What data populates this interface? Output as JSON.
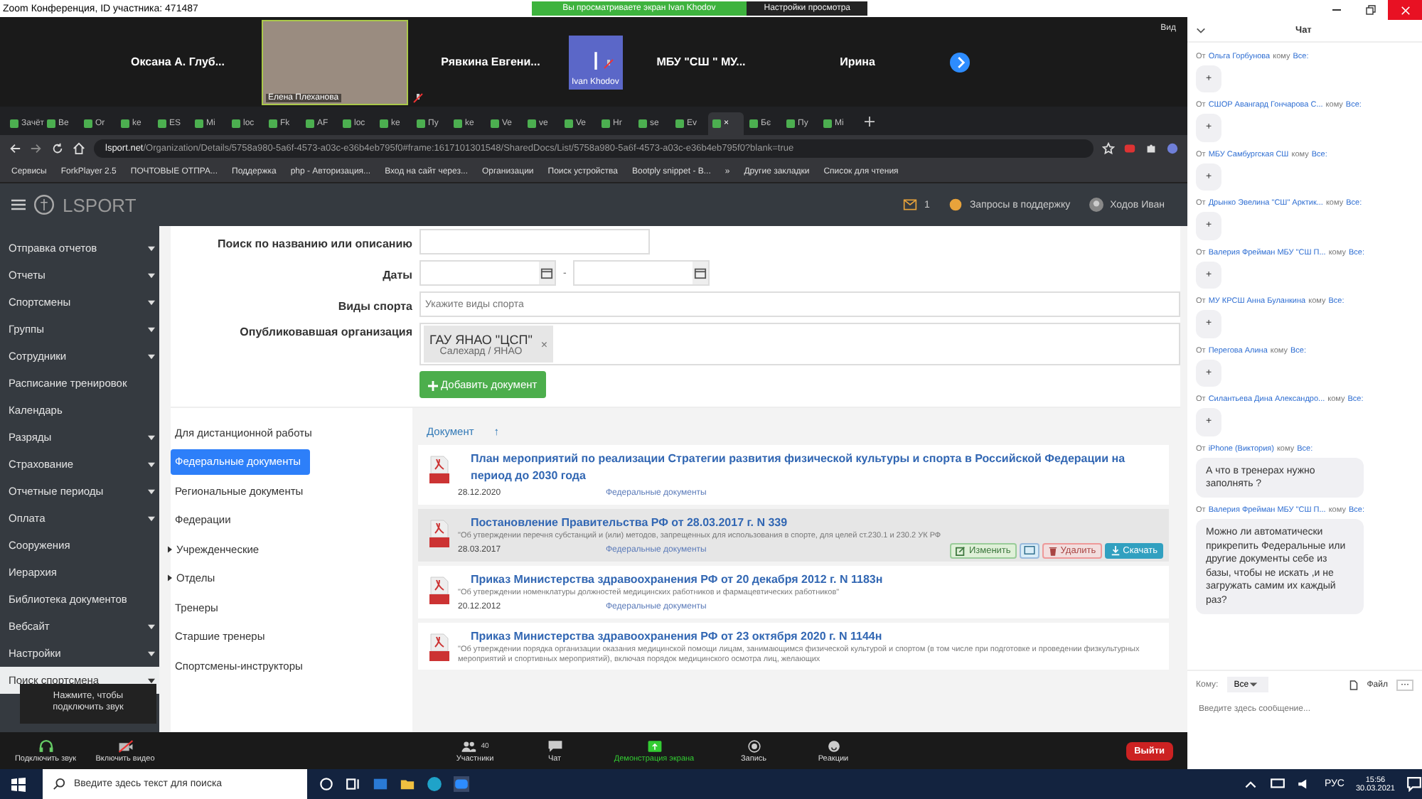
{
  "zoom": {
    "title": "Zoom Конференция, ID участника: 471487",
    "share_banner": "Вы просматриваете экран Ivan Khodov",
    "view_options": "Настройки просмотра"
  },
  "video_strip": {
    "tiles": [
      {
        "kind": "name",
        "name": "Оксана А. Глуб...",
        "muted": false
      },
      {
        "kind": "video",
        "name": "Елена Плеханова",
        "muted": true
      },
      {
        "kind": "name",
        "name": "Рявкина  Евгени...",
        "muted": false
      },
      {
        "kind": "avatar",
        "initial": "I",
        "name": "Ivan Khodov",
        "muted": true
      },
      {
        "kind": "name",
        "name": "МБУ  \"СШ \" МУ...",
        "muted": false
      },
      {
        "kind": "name",
        "name": "Ирина",
        "muted": false
      }
    ],
    "view_label": "Вид"
  },
  "browser": {
    "tabs": [
      {
        "label": "Зачёт",
        "selected": false
      },
      {
        "label": "Be",
        "selected": false
      },
      {
        "label": "Or",
        "selected": false
      },
      {
        "label": "ke",
        "selected": false
      },
      {
        "label": "ES",
        "selected": false
      },
      {
        "label": "Mi",
        "selected": false
      },
      {
        "label": "loc",
        "selected": false
      },
      {
        "label": "Fk",
        "selected": false
      },
      {
        "label": "AF",
        "selected": false
      },
      {
        "label": "loc",
        "selected": false
      },
      {
        "label": "ke",
        "selected": false
      },
      {
        "label": "Пу",
        "selected": false
      },
      {
        "label": "ke",
        "selected": false
      },
      {
        "label": "Ve",
        "selected": false
      },
      {
        "label": "ve",
        "selected": false
      },
      {
        "label": "Ve",
        "selected": false
      },
      {
        "label": "Hr",
        "selected": false
      },
      {
        "label": "se",
        "selected": false
      },
      {
        "label": "Ev",
        "selected": false
      },
      {
        "label": "×",
        "selected": true
      },
      {
        "label": "Бє",
        "selected": false
      },
      {
        "label": "Пу",
        "selected": false
      },
      {
        "label": "Mi",
        "selected": false
      }
    ],
    "url_host": "lsport.net",
    "url_path": "/Organization/Details/5758a980-5a6f-4573-a03c-e36b4eb795f0#frame:1617101301548/SharedDocs/List/5758a980-5a6f-4573-a03c-e36b4eb795f0?blank=true",
    "bookmarks": [
      "Сервисы",
      "ForkPlayer 2.5",
      "ПОЧТОВЫЕ ОТПРА...",
      "Поддержка",
      "php - Авторизация...",
      "Вход на сайт через...",
      "Организации",
      "Поиск устройства",
      "Bootply snippet - B...",
      "»",
      "Другие закладки",
      "Список для чтения"
    ]
  },
  "app": {
    "logo": "LSPORT",
    "messages_count": "1",
    "support": "Запросы в поддержку",
    "user": "Ходов Иван",
    "sidebar": [
      {
        "label": "Отправка отчетов",
        "has_menu": true,
        "selected": false
      },
      {
        "label": "Отчеты",
        "has_menu": true,
        "selected": false
      },
      {
        "label": "Спортсмены",
        "has_menu": true,
        "selected": false
      },
      {
        "label": "Группы",
        "has_menu": true,
        "selected": false
      },
      {
        "label": "Сотрудники",
        "has_menu": true,
        "selected": false
      },
      {
        "label": "Расписание тренировок",
        "has_menu": false,
        "selected": false
      },
      {
        "label": "Календарь",
        "has_menu": false,
        "selected": false
      },
      {
        "label": "Разряды",
        "has_menu": true,
        "selected": false
      },
      {
        "label": "Страхование",
        "has_menu": true,
        "selected": false
      },
      {
        "label": "Отчетные периоды",
        "has_menu": true,
        "selected": false
      },
      {
        "label": "Оплата",
        "has_menu": true,
        "selected": false
      },
      {
        "label": "Сооружения",
        "has_menu": false,
        "selected": false
      },
      {
        "label": "Иерархия",
        "has_menu": false,
        "selected": false
      },
      {
        "label": "Библиотека документов",
        "has_menu": false,
        "selected": false
      },
      {
        "label": "Вебсайт",
        "has_menu": true,
        "selected": false
      },
      {
        "label": "Настройки",
        "has_menu": true,
        "selected": false
      },
      {
        "label": "Поиск спортсмена",
        "has_menu": true,
        "selected": true
      }
    ],
    "filters": {
      "search_label": "Поиск по названию или описанию",
      "dates_label": "Даты",
      "date_separator": "-",
      "sports_label": "Виды спорта",
      "sports_placeholder": "Укажите виды спорта",
      "org_label": "Опубликовавшая организация",
      "org_tag": {
        "name": "ГАУ ЯНАО \"ЦСП\"",
        "place": "Салехард / ЯНАО",
        "remove": "×"
      },
      "add_button": "Добавить документ"
    },
    "folders": [
      {
        "label": "Для дистанционной работы",
        "has_children": false,
        "selected": false
      },
      {
        "label": "Федеральные документы",
        "has_children": false,
        "selected": true
      },
      {
        "label": "Региональные документы",
        "has_children": false,
        "selected": false
      },
      {
        "label": "Федерации",
        "has_children": false,
        "selected": false
      },
      {
        "label": "Учрежденческие",
        "has_children": true,
        "selected": false
      },
      {
        "label": "Отделы",
        "has_children": true,
        "selected": false
      },
      {
        "label": "Тренеры",
        "has_children": false,
        "selected": false
      },
      {
        "label": "Старшие тренеры",
        "has_children": false,
        "selected": false
      },
      {
        "label": "Спортсмены-инструкторы",
        "has_children": false,
        "selected": false
      }
    ],
    "documents_header": {
      "label": "Документ",
      "sort": "↑"
    },
    "documents": [
      {
        "title": "План мероприятий по реализации Стратегии развития физической культуры и спорта в Российской Федерации на период до 2030 года",
        "date": "28.12.2020",
        "category": "Федеральные документы",
        "hovered": false
      },
      {
        "title": "Постановление Правительства РФ от 28.03.2017 г. N 339",
        "description": "\"Об утверждении перечня субстанций и (или) методов, запрещенных для использования в спорте, для целей ст.230.1 и 230.2 УК РФ",
        "date": "28.03.2017",
        "category": "Федеральные документы",
        "hovered": true
      },
      {
        "title": "Приказ Министерства здравоохранения РФ от 20 декабря 2012 г. N 1183н",
        "description": "\"Об утверждении номенклатуры должностей медицинских работников и фармацевтических работников\"",
        "date": "20.12.2012",
        "category": "Федеральные документы",
        "hovered": false
      },
      {
        "title": "Приказ Министерства здравоохранения РФ от 23 октября 2020 г. N 1144н",
        "description": "\"Об утверждении порядка организации оказания медицинской помощи лицам, занимающимся физической культурой и спортом (в том числе при подготовке и проведении физкультурных мероприятий и спортивных мероприятий), включая порядок медицинского осмотра лиц, желающих",
        "hovered": false
      }
    ],
    "row_actions": [
      {
        "kind": "edit",
        "label": "Изменить"
      },
      {
        "kind": "preview"
      },
      {
        "kind": "delete",
        "label": "Удалить"
      },
      {
        "kind": "download",
        "label": "Скачать"
      }
    ]
  },
  "audio_tooltip": "Нажмите, чтобы подключить звук",
  "toolbar": {
    "items": [
      {
        "kind": "audio",
        "label": "Подключить звук"
      },
      {
        "kind": "video",
        "label": "Включить видео"
      },
      {
        "kind": "participants",
        "label": "Участники",
        "count": "40"
      },
      {
        "kind": "chat",
        "label": "Чат"
      },
      {
        "kind": "share",
        "label": "Демонстрация экрана"
      },
      {
        "kind": "record",
        "label": "Запись"
      },
      {
        "kind": "reactions",
        "label": "Реакции"
      }
    ],
    "leave": "Выйти"
  },
  "chat": {
    "title": "Чат",
    "messages": [
      {
        "from_prefix": "От",
        "from": "Ольга Горбунова",
        "to_prefix": "кому",
        "to": "Все:",
        "text": "+"
      },
      {
        "from_prefix": "От",
        "from": "СШОР Авангард Гончарова С...",
        "to_prefix": "кому",
        "to": "Все:",
        "text": "+"
      },
      {
        "from_prefix": "От",
        "from": "МБУ Самбургская СШ",
        "to_prefix": "кому",
        "to": "Все:",
        "text": "+"
      },
      {
        "from_prefix": "От",
        "from": "Дрынко Эвелина \"СШ\" Арктик...",
        "to_prefix": "кому",
        "to": "Все:",
        "text": "+"
      },
      {
        "from_prefix": "От",
        "from": "Валерия Фрейман МБУ \"СШ П...",
        "to_prefix": "кому",
        "to": "Все:",
        "text": "+"
      },
      {
        "from_prefix": "От",
        "from": "МУ КРСШ Анна Буланкина",
        "to_prefix": "кому",
        "to": "Все:",
        "text": "+"
      },
      {
        "from_prefix": "От",
        "from": "Перегова Алина",
        "to_prefix": "кому",
        "to": "Все:",
        "text": "+"
      },
      {
        "from_prefix": "От",
        "from": "Силантьева Дина Александро...",
        "to_prefix": "кому",
        "to": "Все:",
        "text": "+"
      },
      {
        "from_prefix": "От",
        "from": "iPhone (Виктория)",
        "to_prefix": "кому",
        "to": "Все:",
        "text": "А что в тренерах нужно заполнять ?"
      },
      {
        "from_prefix": "От",
        "from": "Валерия Фрейман МБУ \"СШ П...",
        "to_prefix": "кому",
        "to": "Все:",
        "text": "Можно ли автоматически прикрепить Федеральные или другие документы себе из базы, чтобы не искать ,и не загружать самим  их каждый раз?"
      }
    ],
    "to_label": "Кому:",
    "recipient": "Все",
    "file": "Файл",
    "more": "···",
    "input_placeholder": "Введите здесь сообщение..."
  },
  "taskbar": {
    "search_placeholder": "Введите здесь текст для поиска",
    "language": "РУС",
    "time": "15:56",
    "date": "30.03.2021"
  }
}
